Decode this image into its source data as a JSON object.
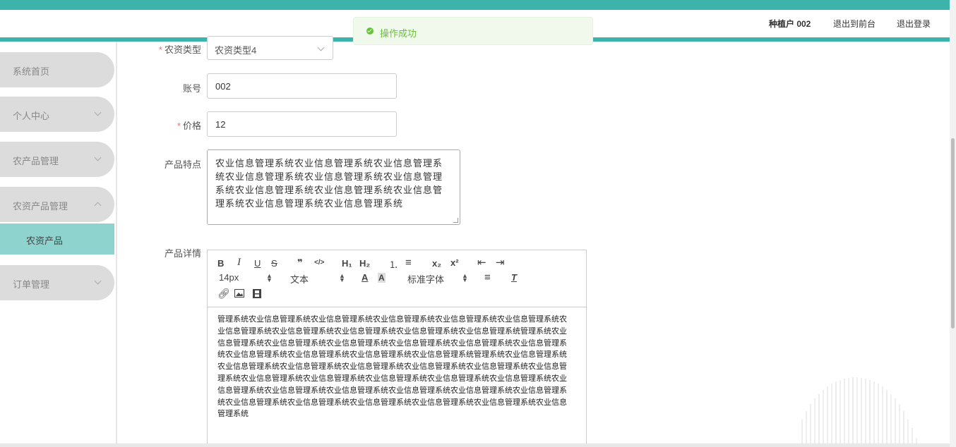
{
  "header": {
    "user": "种植户 002",
    "front_link": "退出到前台",
    "logout_link": "退出登录"
  },
  "toast": {
    "message": "操作成功"
  },
  "sidebar": {
    "items": [
      {
        "label": "系统首页"
      },
      {
        "label": "个人中心"
      },
      {
        "label": "农产品管理"
      },
      {
        "label": "农资产品管理"
      },
      {
        "label": "农资产品"
      },
      {
        "label": "订单管理"
      }
    ]
  },
  "form": {
    "type_label": "农资类型",
    "type_value": "农资类型4",
    "account_label": "账号",
    "account_value": "002",
    "price_label": "价格",
    "price_value": "12",
    "features_label": "产品特点",
    "features_value": "农业信息管理系统农业信息管理系统农业信息管理系统农业信息管理系统农业信息管理系统农业信息管理系统农业信息管理系统农业信息管理系统农业信息管理系统农业信息管理系统农业信息管理系统",
    "detail_label": "产品详情"
  },
  "editor": {
    "toolbar": {
      "bold": "B",
      "italic": "I",
      "underline": "U",
      "strike": "S",
      "quote": "❞",
      "code": "</>",
      "h1": "H₁",
      "h2": "H₂",
      "ordered": "⒈",
      "bullet": "≡",
      "sub": "x₂",
      "sup": "x²",
      "size": "14px",
      "header": "文本",
      "font": "标准字体"
    },
    "content": "管理系统农业信息管理系统农业信息管理系统农业信息管理系统农业信息管理系统农业信息管理系统农业信息管理系统农业信息管理系统农业信息管理系统农业信息管理系统农业信息管理系统管理系统农业信息管理系统农业信息管理系统农业信息管理系统农业信息管理系统农业信息管理系统农业信息管理系统农业信息管理系统农业信息管理系统农业信息管理系统农业信息管理系统管理系统农业信息管理系统农业信息管理系统农业信息管理系统农业信息管理系统农业信息管理系统农业信息管理系统农业信息管理系统农业信息管理系统农业信息管理系统农业信息管理系统农业信息管理系统农业信息管理系统农业信息管理系统农业信息管理系统农业信息管理系统农业信息管理系统农业信息管理系统农业信息管理系统农业信息管理系统农业信息管理系统农业信息管理系统农业信息管理系统农业信息管理系统农业信息管理系统"
  },
  "colors": {
    "accent": "#3cb4ac",
    "sidebar_active": "#8fd3cf",
    "toast_green": "#67c23a"
  }
}
